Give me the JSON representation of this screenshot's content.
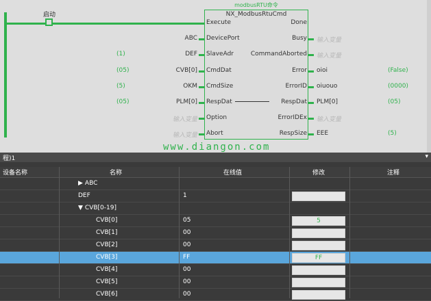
{
  "ladder": {
    "contact_label": "启动",
    "fb_subtitle": "modbusRTU命令",
    "fb_title": "NX_ModbusRtuCmd",
    "inputs": [
      {
        "pin": "Execute",
        "src": "",
        "mon": ""
      },
      {
        "pin": "DevicePort",
        "src": "ABC",
        "mon": ""
      },
      {
        "pin": "SlaveAdr",
        "src": "DEF",
        "mon": "(1)"
      },
      {
        "pin": "CmdDat",
        "src": "CVB[0]",
        "mon": "(05)"
      },
      {
        "pin": "CmdSize",
        "src": "OKM",
        "mon": "(5)"
      },
      {
        "pin": "RespDat",
        "src": "PLM[0]",
        "mon": "(05)"
      },
      {
        "pin": "Option",
        "src": "输入变量",
        "mon": ""
      },
      {
        "pin": "Abort",
        "src": "输入变量",
        "mon": ""
      }
    ],
    "outputs": [
      {
        "pin": "Done",
        "dst": "",
        "mon": ""
      },
      {
        "pin": "Busy",
        "dst": "输入变量",
        "mon": ""
      },
      {
        "pin": "CommandAborted",
        "dst": "输入变量",
        "mon": ""
      },
      {
        "pin": "Error",
        "dst": "oioi",
        "mon": "(False)"
      },
      {
        "pin": "ErrorID",
        "dst": "oiuouo",
        "mon": "(0000)"
      },
      {
        "pin": "RespDat",
        "dst": "PLM[0]",
        "mon": "(05)"
      },
      {
        "pin": "ErrorIDEx",
        "dst": "输入变量",
        "mon": ""
      },
      {
        "pin": "RespSize",
        "dst": "EEE",
        "mon": "(5)"
      }
    ],
    "watermark": "www.diangon.com"
  },
  "tab": {
    "label": "程)1",
    "close": "▾"
  },
  "table": {
    "headers": [
      "设备名称",
      "名称",
      "在线值",
      "修改",
      "注释"
    ],
    "rows": [
      {
        "name": "ABC",
        "arrow": "▶",
        "indent": 1,
        "value": "",
        "edit": "",
        "editable": false,
        "selected": false
      },
      {
        "name": "DEF",
        "arrow": "",
        "indent": 1,
        "value": "1",
        "edit": "",
        "editable": true,
        "selected": false
      },
      {
        "name": "CVB[0-19]",
        "arrow": "▼",
        "indent": 1,
        "value": "",
        "edit": "",
        "editable": false,
        "selected": false
      },
      {
        "name": "CVB[0]",
        "arrow": "",
        "indent": 2,
        "value": "05",
        "edit": "5",
        "editable": true,
        "selected": false
      },
      {
        "name": "CVB[1]",
        "arrow": "",
        "indent": 2,
        "value": "00",
        "edit": "",
        "editable": true,
        "selected": false
      },
      {
        "name": "CVB[2]",
        "arrow": "",
        "indent": 2,
        "value": "00",
        "edit": "",
        "editable": true,
        "selected": false
      },
      {
        "name": "CVB[3]",
        "arrow": "",
        "indent": 2,
        "value": "FF",
        "edit": "FF",
        "editable": true,
        "selected": true
      },
      {
        "name": "CVB[4]",
        "arrow": "",
        "indent": 2,
        "value": "00",
        "edit": "",
        "editable": true,
        "selected": false
      },
      {
        "name": "CVB[5]",
        "arrow": "",
        "indent": 2,
        "value": "00",
        "edit": "",
        "editable": true,
        "selected": false
      },
      {
        "name": "CVB[6]",
        "arrow": "",
        "indent": 2,
        "value": "00",
        "edit": "",
        "editable": true,
        "selected": false
      }
    ]
  },
  "colors": {
    "accent": "#2fb24c",
    "selection": "#5aa6dc"
  }
}
